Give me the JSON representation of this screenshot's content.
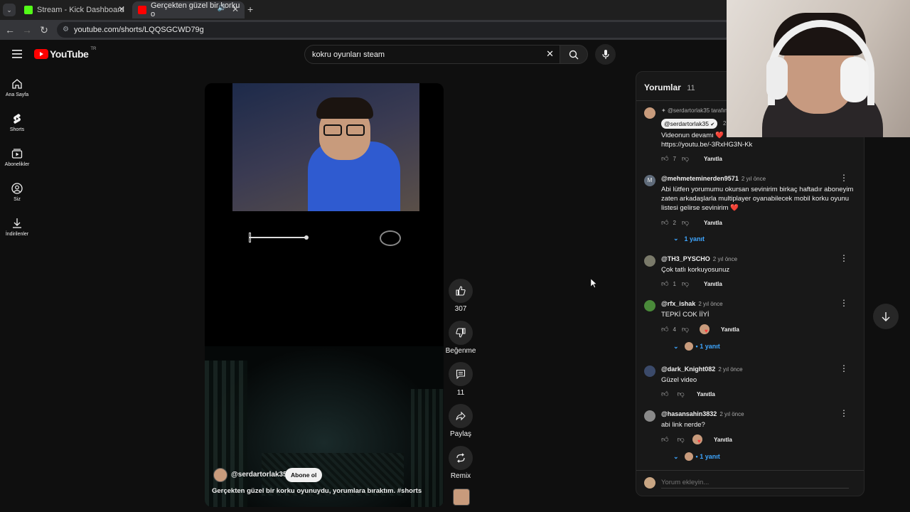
{
  "browser": {
    "tabs": [
      {
        "title": "Stream - Kick Dashboard",
        "favicon_color": "#53fc18"
      },
      {
        "title": "Gerçekten güzel bir korku o",
        "favicon_color": "#ff0000"
      }
    ],
    "new_tab": "+",
    "url": "youtube.com/shorts/LQQSGCWD79g"
  },
  "header": {
    "logo": "YouTube",
    "country": "TR",
    "search_value": "kokru oyunları steam"
  },
  "nav": [
    {
      "label": "Ana Sayfa",
      "icon": "home-icon"
    },
    {
      "label": "Shorts",
      "icon": "shorts-icon"
    },
    {
      "label": "Abonelikler",
      "icon": "subscriptions-icon"
    },
    {
      "label": "Siz",
      "icon": "you-icon"
    },
    {
      "label": "İndirilenler",
      "icon": "download-icon"
    }
  ],
  "video": {
    "channel": "@serdartorlak35",
    "subscribe": "Abone ol",
    "caption": "Gerçekten güzel bir korku oyunuydu, yorumlara bıraktım.",
    "hashtag": "#shorts"
  },
  "actions": {
    "likes": "307",
    "dislike": "Beğenme",
    "comments": "11",
    "share": "Paylaş",
    "remix": "Remix"
  },
  "comments_panel": {
    "title": "Yorumlar",
    "count": "11",
    "add_placeholder": "Yorum ekleyin...",
    "reply_label": "Yanıtla",
    "pinned": {
      "pinned_by": "@serdartorlak35 tarafın",
      "author": "@serdartorlak35",
      "time": "2",
      "text1": "Videonun devamı ❤️",
      "text2": "https://youtu.be/-3RxHG3N-Kk",
      "likes": "7"
    },
    "items": [
      {
        "author": "@mehmeteminerden9571",
        "time": "2 yıl önce",
        "text": "Abi lütfen yorumumu okursan sevinirim birkaç haftadır aboneyim zaten arkadaşlarla multiplayer oyanabilecek mobil korku oyunu listesi gelirse sevinirim ❤️",
        "likes": "2",
        "replies": "1 yanıt"
      },
      {
        "author": "@TH3_PYSCHO",
        "time": "2 yıl önce",
        "text": "Çok tatlı korkuyosunuz",
        "likes": "1",
        "replies": ""
      },
      {
        "author": "@rfx_ishak",
        "time": "2 yıl önce",
        "text": "TEPKİ COK İİYİ",
        "likes": "4",
        "replies": "• 1 yanıt"
      },
      {
        "author": "@dark_Knight082",
        "time": "2 yıl önce",
        "text": "Güzel video",
        "likes": "",
        "replies": ""
      },
      {
        "author": "@hasansahin3832",
        "time": "2 yıl önce",
        "text": "abi link nerde?",
        "likes": "",
        "replies": "• 1 yanıt"
      }
    ]
  },
  "colors": {
    "accent": "#3ea6ff",
    "brand_red": "#ff0000",
    "bg": "#0f0f0f"
  }
}
